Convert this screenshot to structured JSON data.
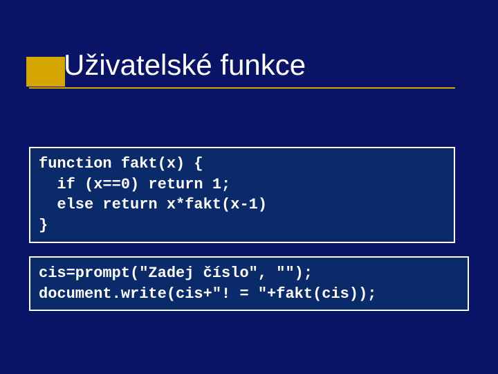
{
  "title": "Uživatelské funkce",
  "code_blocks": {
    "block1": "function fakt(x) {\n  if (x==0) return 1;\n  else return x*fakt(x-1)\n}",
    "block2": "cis=prompt(\"Zadej číslo\", \"\");\ndocument.write(cis+\"! = \"+fakt(cis));"
  }
}
